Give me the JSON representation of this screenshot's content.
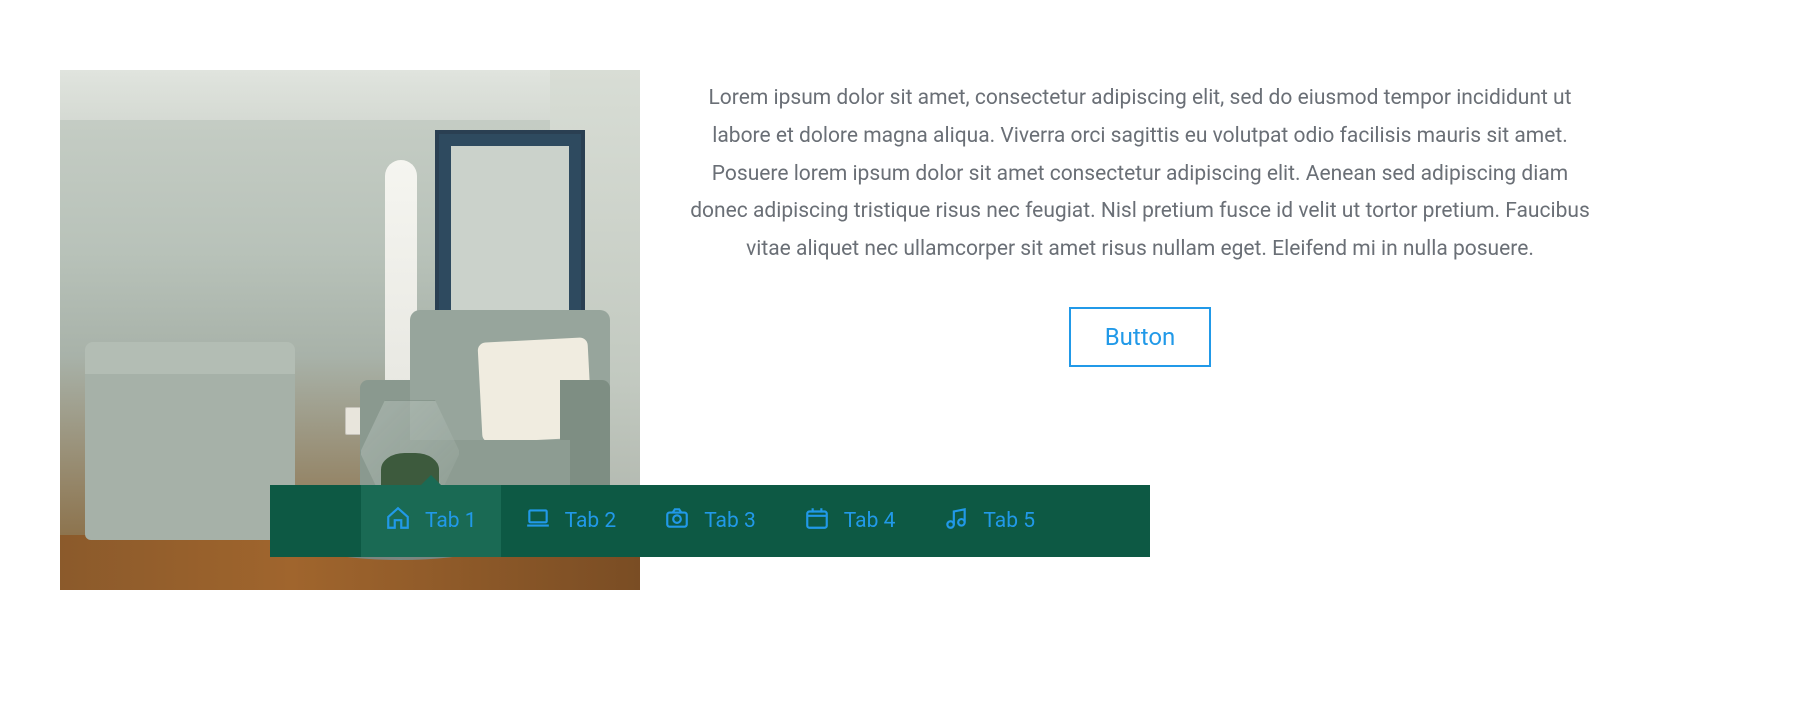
{
  "content": {
    "body_text": "Lorem ipsum dolor sit amet, consectetur adipiscing elit, sed do eiusmod tempor incididunt ut labore et dolore magna aliqua. Viverra orci sagittis eu volutpat odio facilisis mauris sit amet. Posuere lorem ipsum dolor sit amet consectetur adipiscing elit. Aenean sed adipiscing diam donec adipiscing tristique risus nec feugiat. Nisl pretium fusce id velit ut tortor pretium. Faucibus vitae aliquet nec ullamcorper sit amet risus nullam eget. Eleifend mi in nulla posuere.",
    "button_label": "Button"
  },
  "tabs": [
    {
      "label": "Tab 1",
      "icon": "home-icon",
      "active": true
    },
    {
      "label": "Tab 2",
      "icon": "laptop-icon",
      "active": false
    },
    {
      "label": "Tab 3",
      "icon": "camera-icon",
      "active": false
    },
    {
      "label": "Tab 4",
      "icon": "calendar-icon",
      "active": false
    },
    {
      "label": "Tab 5",
      "icon": "music-icon",
      "active": false
    }
  ],
  "colors": {
    "tab_bar_bg": "#0d5944",
    "tab_active_bg": "#1a6a54",
    "accent": "#2199e8",
    "text": "#6a6f76"
  }
}
